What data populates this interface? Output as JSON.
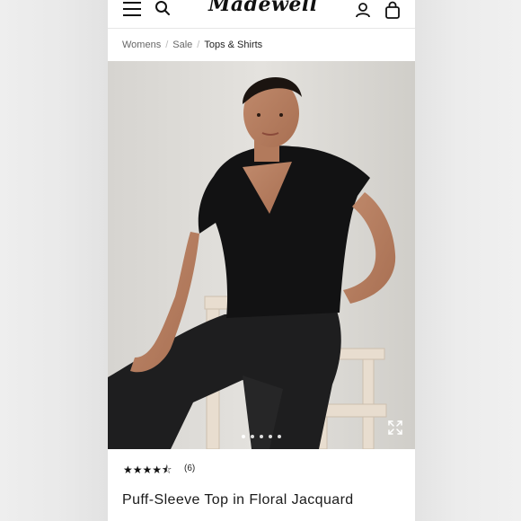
{
  "header": {
    "logo": "Madewell",
    "icons": [
      "menu-icon",
      "search-icon",
      "account-icon",
      "bag-icon"
    ]
  },
  "breadcrumb": {
    "items": [
      "Womens",
      "Sale",
      "Tops & Shirts"
    ],
    "separator": "/"
  },
  "gallery": {
    "slide_count": 5,
    "active_index": 0,
    "expand_icon": "expand-icon"
  },
  "product": {
    "rating": 4.5,
    "stars": "★★★★⯪",
    "review_count": "(6)",
    "title": "Puff-Sleeve Top in Floral Jacquard"
  },
  "colors": {
    "background": "#f1f1f1",
    "page": "#ffffff",
    "text": "#1a1a1a",
    "muted": "#666666"
  }
}
